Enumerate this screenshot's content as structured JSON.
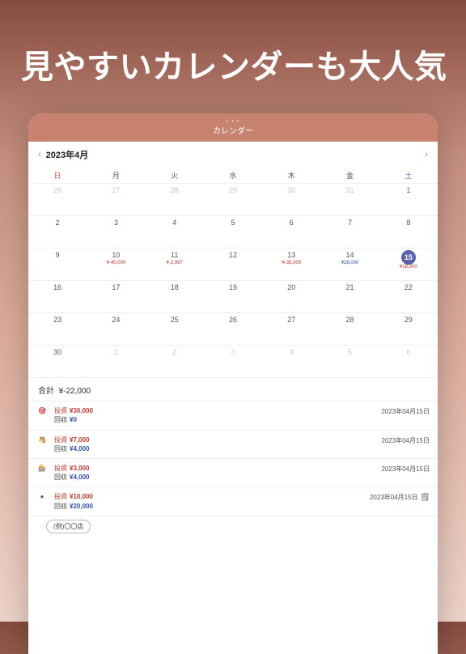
{
  "pageTitle": "見やすいカレンダーも大人気",
  "topbar": {
    "label": "カレンダー"
  },
  "month": {
    "label": "2023年4月",
    "prev": "‹",
    "next": "›"
  },
  "dow": [
    "日",
    "月",
    "火",
    "水",
    "木",
    "金",
    "土"
  ],
  "cells": [
    {
      "d": "26",
      "out": true
    },
    {
      "d": "27",
      "out": true
    },
    {
      "d": "28",
      "out": true
    },
    {
      "d": "29",
      "out": true
    },
    {
      "d": "30",
      "out": true
    },
    {
      "d": "31",
      "out": true
    },
    {
      "d": "1"
    },
    {
      "d": "2"
    },
    {
      "d": "3"
    },
    {
      "d": "4"
    },
    {
      "d": "5"
    },
    {
      "d": "6"
    },
    {
      "d": "7"
    },
    {
      "d": "8"
    },
    {
      "d": "9"
    },
    {
      "d": "10",
      "neg": "¥-40,000"
    },
    {
      "d": "11",
      "neg": "¥-2,997"
    },
    {
      "d": "12"
    },
    {
      "d": "13",
      "neg": "¥-35,000"
    },
    {
      "d": "14",
      "pos": "¥28,000"
    },
    {
      "d": "15",
      "sel": true,
      "neg": "¥18,000"
    },
    {
      "d": "16"
    },
    {
      "d": "17"
    },
    {
      "d": "18"
    },
    {
      "d": "19"
    },
    {
      "d": "20"
    },
    {
      "d": "21"
    },
    {
      "d": "22"
    },
    {
      "d": "23"
    },
    {
      "d": "24"
    },
    {
      "d": "25"
    },
    {
      "d": "26"
    },
    {
      "d": "27"
    },
    {
      "d": "28"
    },
    {
      "d": "29"
    },
    {
      "d": "30"
    },
    {
      "d": "1",
      "out": true
    },
    {
      "d": "2",
      "out": true
    },
    {
      "d": "3",
      "out": true
    },
    {
      "d": "4",
      "out": true
    },
    {
      "d": "5",
      "out": true
    },
    {
      "d": "6",
      "out": true
    }
  ],
  "summary": {
    "label": "合計",
    "value": "¥-22,000"
  },
  "labels": {
    "invest": "投資",
    "recover": "回収"
  },
  "items": [
    {
      "icon": "🎯",
      "iconName": "pachinko-icon",
      "invest": "¥30,000",
      "recover": "¥0",
      "date": "2023年04月15日",
      "note": false
    },
    {
      "icon": "🐴",
      "iconName": "horse-icon",
      "invest": "¥7,000",
      "recover": "¥4,000",
      "date": "2023年04月15日",
      "note": false
    },
    {
      "icon": "🎰",
      "iconName": "slot-icon",
      "invest": "¥3,000",
      "recover": "¥4,000",
      "date": "2023年04月15日",
      "note": false
    },
    {
      "icon": "●",
      "iconName": "other-icon",
      "invest": "¥10,000",
      "recover": "¥20,000",
      "date": "2023年04月15日",
      "note": true,
      "tag": "(例)〇〇店"
    }
  ]
}
